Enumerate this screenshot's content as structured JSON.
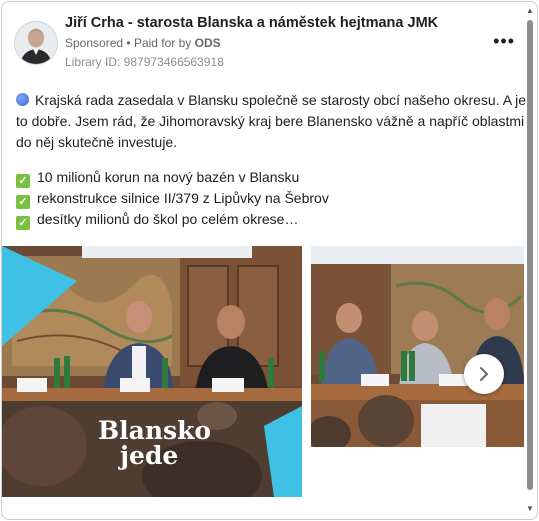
{
  "post": {
    "page_name": "Jiří Crha - starosta Blanska a náměstek hejtmana JMK",
    "sponsored": "Sponsored",
    "separator": "•",
    "paid_for_label": "Paid for by",
    "paid_for_by": "ODS",
    "library_id": "Library ID: 987973466563918",
    "more_icon": "more-horizontal-icon"
  },
  "body": {
    "paragraph1_line1": "Krajská rada zasedala v Blansku společně se starosty obcí našeho okresu. A je",
    "paragraph1_line2": "to dobře. Jsem rád, že Jihomoravský kraj bere Blanensko vážně a napříč oblastmi",
    "paragraph1_line3": "do něj skutečně investuje.",
    "items": [
      "10 milionů korun na nový bazén v Blansku",
      "rekonstrukce silnice II/379 z Lipůvky na Šebrov",
      "desítky milionů do škol po celém okrese…"
    ]
  },
  "carousel": {
    "logo_line1": "Blansko",
    "logo_line2": "jede",
    "accent_color": "#3fc1e6",
    "next_icon": "chevron-right-icon"
  }
}
